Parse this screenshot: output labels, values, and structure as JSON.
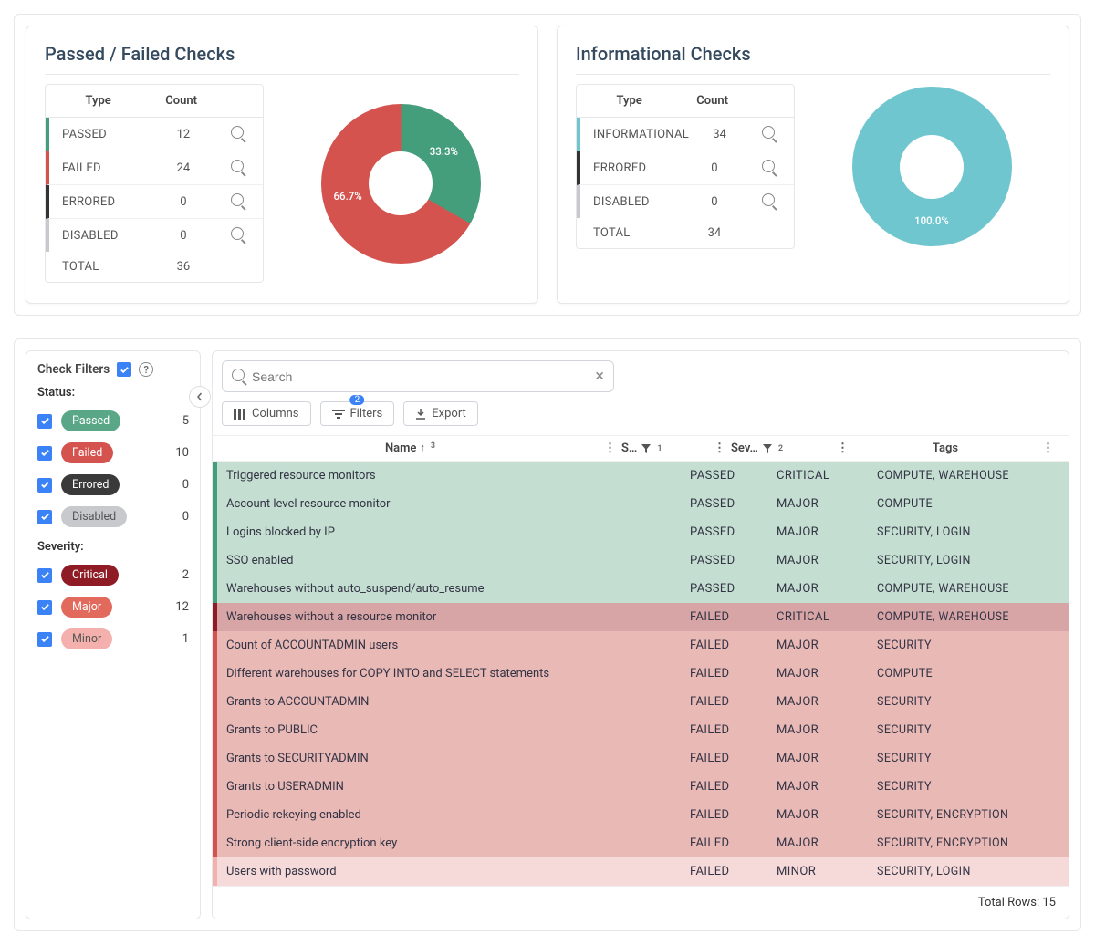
{
  "chart_data": [
    {
      "type": "pie",
      "title": "Passed / Failed Checks",
      "series": [
        {
          "name": "PASSED",
          "count": 12,
          "percent": 33.3,
          "color": "#459e7b"
        },
        {
          "name": "FAILED",
          "count": 24,
          "percent": 66.7,
          "color": "#d4534f"
        },
        {
          "name": "ERRORED",
          "count": 0,
          "percent": 0,
          "color": "#333333"
        },
        {
          "name": "DISABLED",
          "count": 0,
          "percent": 0,
          "color": "#c7c9cc"
        }
      ],
      "total": 36
    },
    {
      "type": "pie",
      "title": "Informational Checks",
      "series": [
        {
          "name": "INFORMATIONAL",
          "count": 34,
          "percent": 100.0,
          "color": "#6fc6ce"
        },
        {
          "name": "ERRORED",
          "count": 0,
          "percent": 0,
          "color": "#333333"
        },
        {
          "name": "DISABLED",
          "count": 0,
          "percent": 0,
          "color": "#c7c9cc"
        }
      ],
      "total": 34
    }
  ],
  "card_labels": {
    "type": "Type",
    "count": "Count",
    "total": "TOTAL"
  },
  "filters": {
    "title": "Check Filters",
    "status_label": "Status:",
    "severity_label": "Severity:",
    "status": [
      {
        "key": "passed",
        "label": "Passed",
        "color": "#5aa787",
        "count": 5,
        "checked": true
      },
      {
        "key": "failed",
        "label": "Failed",
        "color": "#d4534f",
        "count": 10,
        "checked": true
      },
      {
        "key": "errored",
        "label": "Errored",
        "color": "#3a3a3a",
        "count": 0,
        "checked": true
      },
      {
        "key": "disabled",
        "label": "Disabled",
        "color": "#c7c9cc",
        "text": "#555",
        "count": 0,
        "checked": true
      }
    ],
    "severity": [
      {
        "key": "critical",
        "label": "Critical",
        "color": "#8f1b24",
        "count": 2,
        "checked": true
      },
      {
        "key": "major",
        "label": "Major",
        "color": "#e26a5c",
        "count": 12,
        "checked": true
      },
      {
        "key": "minor",
        "label": "Minor",
        "color": "#f3b0ad",
        "text": "#555",
        "count": 1,
        "checked": true
      }
    ]
  },
  "search": {
    "placeholder": "Search"
  },
  "toolbar": {
    "columns": "Columns",
    "filters": "Filters",
    "filters_badge": "2",
    "export": "Export"
  },
  "grid": {
    "columns": {
      "name": "Name",
      "status": "S…",
      "severity": "Sev…",
      "tags": "Tags",
      "sort_sup_name": "3",
      "sort_sup_status": "1",
      "sort_sup_sev": "2"
    },
    "rows": [
      {
        "name": "Triggered resource monitors",
        "status": "PASSED",
        "severity": "CRITICAL",
        "tags": "COMPUTE, WAREHOUSE"
      },
      {
        "name": "Account level resource monitor",
        "status": "PASSED",
        "severity": "MAJOR",
        "tags": "COMPUTE"
      },
      {
        "name": "Logins blocked by IP",
        "status": "PASSED",
        "severity": "MAJOR",
        "tags": "SECURITY, LOGIN"
      },
      {
        "name": "SSO enabled",
        "status": "PASSED",
        "severity": "MAJOR",
        "tags": "SECURITY, LOGIN"
      },
      {
        "name": "Warehouses without auto_suspend/auto_resume",
        "status": "PASSED",
        "severity": "MAJOR",
        "tags": "COMPUTE, WAREHOUSE"
      },
      {
        "name": "Warehouses without a resource monitor",
        "status": "FAILED",
        "severity": "CRITICAL",
        "tags": "COMPUTE, WAREHOUSE"
      },
      {
        "name": "Count of ACCOUNTADMIN users",
        "status": "FAILED",
        "severity": "MAJOR",
        "tags": "SECURITY"
      },
      {
        "name": "Different warehouses for COPY INTO and SELECT statements",
        "status": "FAILED",
        "severity": "MAJOR",
        "tags": "COMPUTE"
      },
      {
        "name": "Grants to ACCOUNTADMIN",
        "status": "FAILED",
        "severity": "MAJOR",
        "tags": "SECURITY"
      },
      {
        "name": "Grants to PUBLIC",
        "status": "FAILED",
        "severity": "MAJOR",
        "tags": "SECURITY"
      },
      {
        "name": "Grants to SECURITYADMIN",
        "status": "FAILED",
        "severity": "MAJOR",
        "tags": "SECURITY"
      },
      {
        "name": "Grants to USERADMIN",
        "status": "FAILED",
        "severity": "MAJOR",
        "tags": "SECURITY"
      },
      {
        "name": "Periodic rekeying enabled",
        "status": "FAILED",
        "severity": "MAJOR",
        "tags": "SECURITY, ENCRYPTION"
      },
      {
        "name": "Strong client-side encryption key",
        "status": "FAILED",
        "severity": "MAJOR",
        "tags": "SECURITY, ENCRYPTION"
      },
      {
        "name": "Users with password",
        "status": "FAILED",
        "severity": "MINOR",
        "tags": "SECURITY, LOGIN"
      }
    ],
    "total_rows_label": "Total Rows: 15"
  },
  "row_styles": {
    "PASSED": {
      "bg": "#c4dfd1",
      "bar": "#459e7b"
    },
    "FAILED_CRITICAL": {
      "bg": "#d7a5a5",
      "bar": "#8f1b24"
    },
    "FAILED_MAJOR": {
      "bg": "#e9b9b6",
      "bar": "#d4534f"
    },
    "FAILED_MINOR": {
      "bg": "#f6dada",
      "bar": "#f3b0ad"
    }
  }
}
